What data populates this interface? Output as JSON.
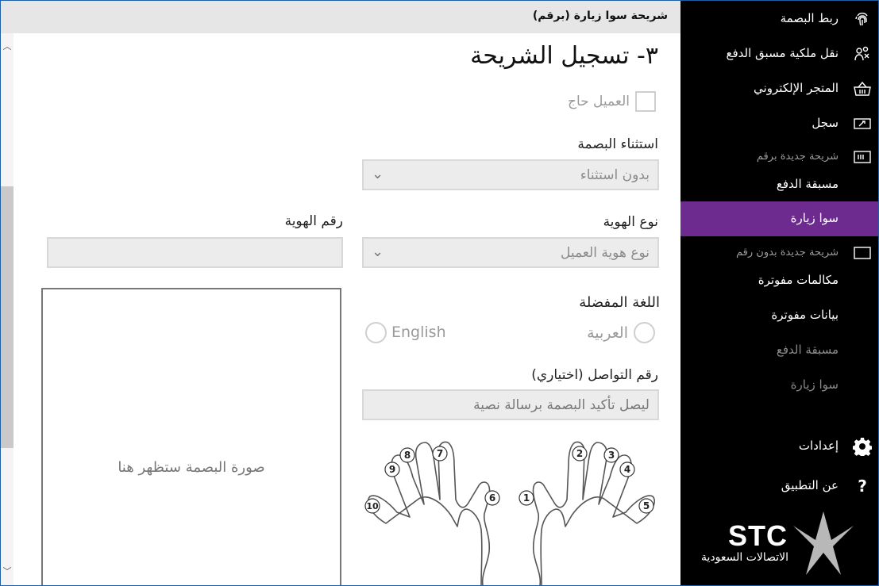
{
  "header": {
    "title": "شريحة سوا زيارة (برقم)"
  },
  "page": {
    "heading": "٣- تسجيل الشريحة"
  },
  "form": {
    "customer_needy_label": "العميل حاج",
    "fingerprint_exception_label": "استثناء البصمة",
    "fingerprint_exception_value": "بدون استثناء",
    "id_type_label": "نوع الهوية",
    "id_type_value": "نوع هوية العميل",
    "id_number_label": "رقم الهوية",
    "id_number_value": "",
    "language_label": "اللغة المفضلة",
    "language_options": [
      "العربية",
      "English"
    ],
    "contact_label": "رقم التواصل (اختياري)",
    "contact_placeholder": "ليصل تأكيد البصمة برسالة نصية",
    "fingerprint_placeholder": "صورة البصمة ستظهر هنا"
  },
  "fingers": [
    "1",
    "2",
    "3",
    "4",
    "5",
    "6",
    "7",
    "8",
    "9",
    "10"
  ],
  "sidebar": {
    "items": [
      {
        "label": "ربط البصمة",
        "icon": "fingerprint-icon"
      },
      {
        "label": "نقل ملكية مسبق الدفع",
        "icon": "transfer-users-icon"
      },
      {
        "label": "المتجر الإلكتروني",
        "icon": "basket-icon"
      },
      {
        "label": "سجل",
        "icon": "ticket-icon"
      },
      {
        "label": "شريحة جديدة برقم",
        "icon": "sim-card-icon"
      },
      {
        "label": "مسبقة الدفع"
      },
      {
        "label": "سوا زيارة"
      },
      {
        "label": "شريحة جديدة بدون رقم",
        "icon": "sim-blank-icon"
      },
      {
        "label": "مكالمات مفوترة"
      },
      {
        "label": "بيانات مفوترة"
      },
      {
        "label": "مسبقة الدفع"
      },
      {
        "label": "سوا زيارة"
      },
      {
        "label": "إعدادات",
        "icon": "gear-icon"
      },
      {
        "label": "عن التطبيق",
        "icon": "question-icon"
      }
    ],
    "active_color": "#6d2b8f"
  },
  "logo": {
    "text": "STC",
    "arabic": "الاتصالات السعودية"
  }
}
